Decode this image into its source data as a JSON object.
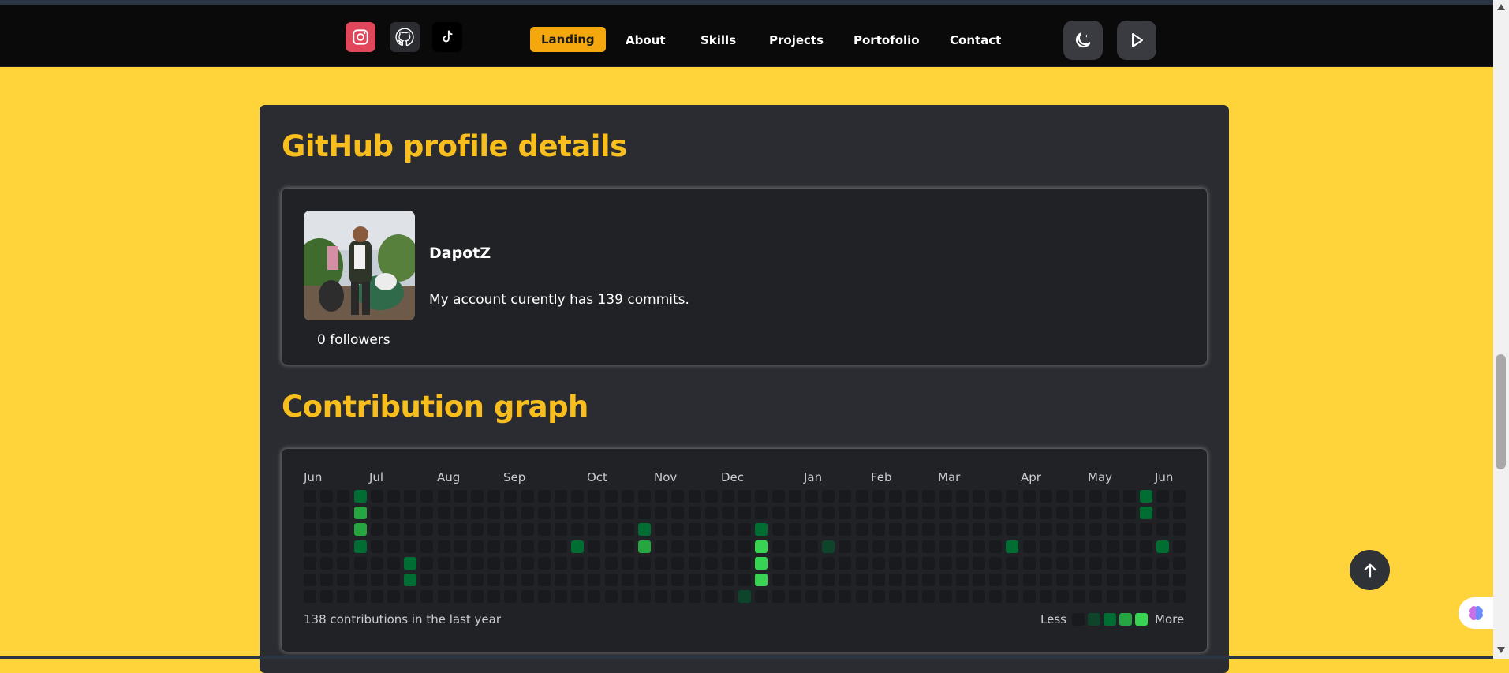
{
  "nav": {
    "social": [
      {
        "name": "instagram-icon",
        "color": "#e0475b"
      },
      {
        "name": "github-icon",
        "color": "#2b2d31"
      },
      {
        "name": "tiktok-icon",
        "color": "#000000"
      }
    ],
    "links": [
      {
        "label": "Landing",
        "active": true
      },
      {
        "label": "About"
      },
      {
        "label": "Skills"
      },
      {
        "label": "Projects"
      },
      {
        "label": "Portofolio"
      },
      {
        "label": "Contact"
      }
    ],
    "buttons": [
      "moon-icon",
      "play-icon"
    ]
  },
  "profile": {
    "title": "GitHub profile details",
    "username": "DapotZ",
    "commits_text": "My account curently has 139 commits.",
    "followers_text": "0 followers"
  },
  "contrib": {
    "title": "Contribution graph",
    "months": [
      "Jun",
      "Jul",
      "Aug",
      "Sep",
      "Oct",
      "Nov",
      "Dec",
      "Jan",
      "Feb",
      "Mar",
      "Apr",
      "May",
      "Jun"
    ],
    "summary": "138 contributions in the last year",
    "legend_less": "Less",
    "legend_more": "More",
    "level_colors": [
      "#191a1d",
      "#0e4429",
      "#006d32",
      "#26a641",
      "#39d353"
    ],
    "weeks": 53,
    "days": 7,
    "active_cells": [
      {
        "week": 3,
        "day": 0,
        "level": 2
      },
      {
        "week": 3,
        "day": 1,
        "level": 3
      },
      {
        "week": 3,
        "day": 2,
        "level": 3
      },
      {
        "week": 3,
        "day": 3,
        "level": 2
      },
      {
        "week": 6,
        "day": 4,
        "level": 2
      },
      {
        "week": 6,
        "day": 5,
        "level": 2
      },
      {
        "week": 16,
        "day": 3,
        "level": 2
      },
      {
        "week": 20,
        "day": 2,
        "level": 2
      },
      {
        "week": 20,
        "day": 3,
        "level": 3
      },
      {
        "week": 26,
        "day": 6,
        "level": 1
      },
      {
        "week": 27,
        "day": 2,
        "level": 2
      },
      {
        "week": 27,
        "day": 3,
        "level": 4
      },
      {
        "week": 27,
        "day": 4,
        "level": 4
      },
      {
        "week": 27,
        "day": 5,
        "level": 4
      },
      {
        "week": 31,
        "day": 3,
        "level": 1
      },
      {
        "week": 42,
        "day": 3,
        "level": 2
      },
      {
        "week": 50,
        "day": 0,
        "level": 2
      },
      {
        "week": 50,
        "day": 1,
        "level": 2
      },
      {
        "week": 51,
        "day": 3,
        "level": 2
      }
    ]
  }
}
